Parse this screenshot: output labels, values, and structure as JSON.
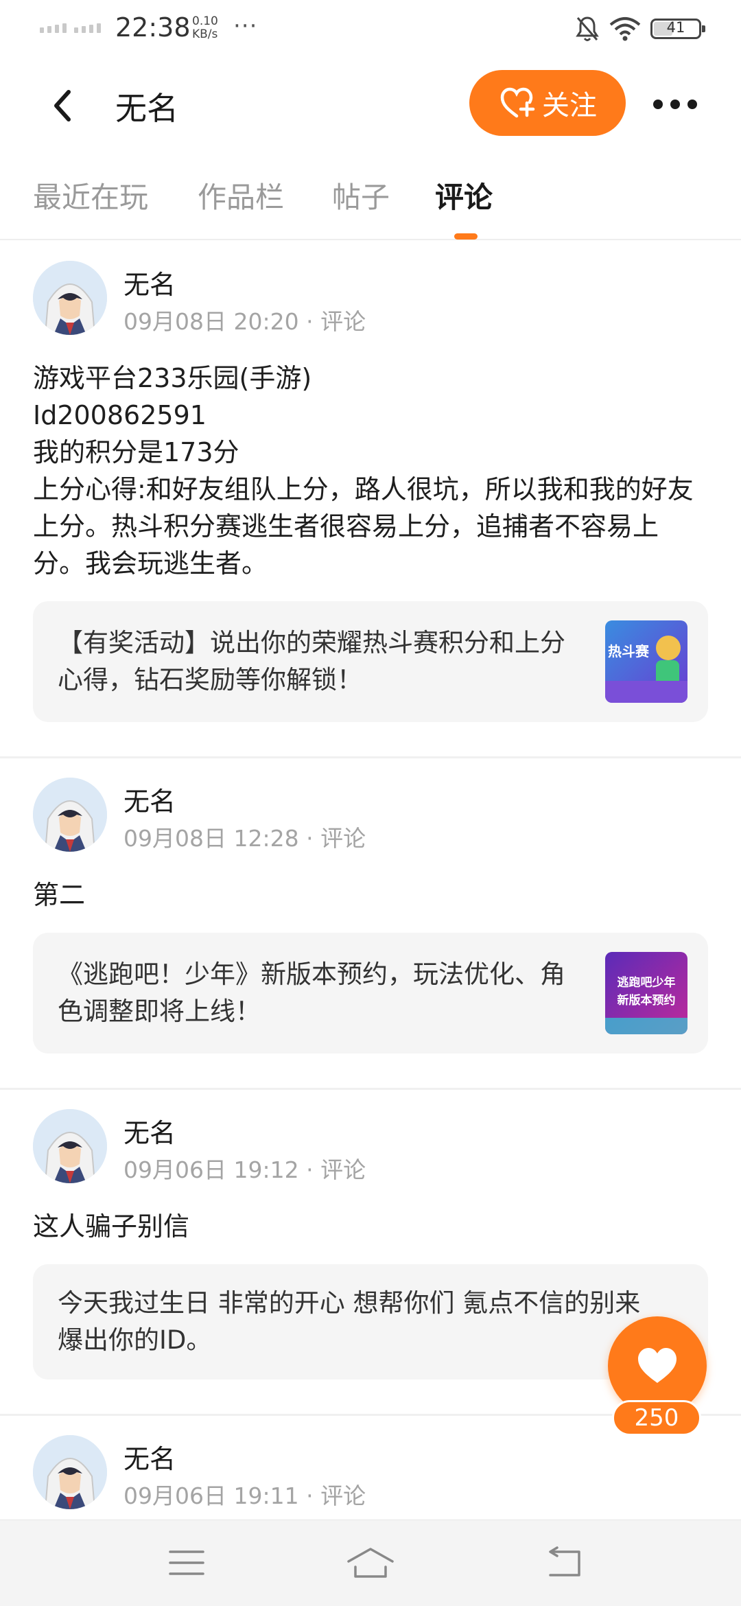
{
  "status_bar": {
    "time": "22:38",
    "net_speed_value": "0.10",
    "net_speed_unit": "KB/s",
    "dots": "···",
    "battery_level": "41",
    "icons": [
      "signal-icon",
      "bell-off-icon",
      "wifi-icon",
      "battery-icon"
    ]
  },
  "header": {
    "back_icon": "chevron-left-icon",
    "title": "无名",
    "follow_label": "关注",
    "follow_icon": "heart-plus-icon",
    "more_icon": "more-icon"
  },
  "tabs": [
    {
      "label": "最近在玩",
      "active": false
    },
    {
      "label": "作品栏",
      "active": false
    },
    {
      "label": "帖子",
      "active": false
    },
    {
      "label": "评论",
      "active": true
    }
  ],
  "colors": {
    "accent": "#ff7a1a",
    "card_bg": "#f5f5f5",
    "meta_text": "#a4a4a4"
  },
  "posts": [
    {
      "username": "无名",
      "date": "09月08日 20:20",
      "type": "评论",
      "body": "游戏平台233乐园(手游)\nId200862591\n我的积分是173分\n上分心得:和好友组队上分，路人很坑，所以我和我的好友上分。热斗积分赛逃生者很容易上分，追捕者不容易上分。我会玩逃生者。",
      "ref_text": "【有奖活动】说出你的荣耀热斗赛积分和上分心得，钻石奖励等你解锁！",
      "ref_thumb_text": "热斗赛"
    },
    {
      "username": "无名",
      "date": "09月08日 12:28",
      "type": "评论",
      "body": "第二",
      "ref_text": "《逃跑吧！少年》新版本预约，玩法优化、角色调整即将上线！",
      "ref_thumb_text": "逃跑吧少年新版本预约"
    },
    {
      "username": "无名",
      "date": "09月06日 19:12",
      "type": "评论",
      "body": "这人骗子别信",
      "ref_text": "今天我过生日 非常的开心 想帮你们 氪点不信的别来 爆出你的ID。",
      "ref_thumb_text": ""
    },
    {
      "username": "无名",
      "date": "09月06日 19:11",
      "type": "评论",
      "body": "",
      "ref_text": "",
      "ref_thumb_text": ""
    }
  ],
  "like": {
    "count": "250",
    "icon": "heart-icon"
  },
  "nav_bar": {
    "icons": [
      "menu-icon",
      "home-icon",
      "back-nav-icon"
    ]
  }
}
